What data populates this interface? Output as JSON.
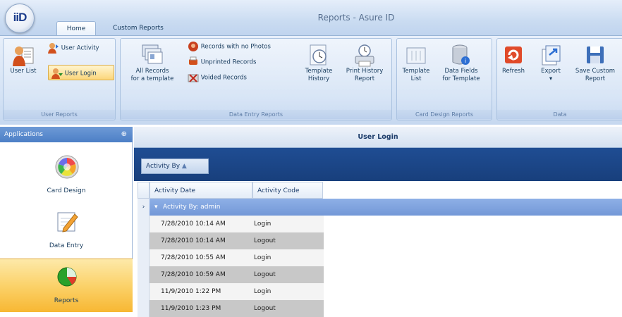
{
  "window": {
    "title": "Reports - Asure ID",
    "logo_text": "iiD"
  },
  "tabs": [
    {
      "label": "Home",
      "active": true
    },
    {
      "label": "Custom Reports",
      "active": false
    }
  ],
  "ribbon": {
    "groups": [
      {
        "name": "User Reports",
        "buttons": [
          "User List",
          "User Activity",
          "User Login"
        ]
      },
      {
        "name": "Data Entry Reports",
        "buttons": [
          "All Records for a template",
          "Records with no Photos",
          "Unprinted Records",
          "Voided Records",
          "Template History",
          "Print History Report"
        ]
      },
      {
        "name": "Card Design Reports",
        "buttons": [
          "Template List",
          "Data Fields for Template"
        ]
      },
      {
        "name": "Data",
        "buttons": [
          "Refresh",
          "Export",
          "Save Custom Report"
        ]
      }
    ],
    "labels": {
      "user_list": "User List",
      "user_activity": "User Activity",
      "user_login": "User Login",
      "all_records_1": "All Records",
      "all_records_2": "for a template",
      "no_photos": "Records with no Photos",
      "unprinted": "Unprinted Records",
      "voided": "Voided Records",
      "template_history_1": "Template",
      "template_history_2": "History",
      "print_history_1": "Print History",
      "print_history_2": "Report",
      "template_list_1": "Template",
      "template_list_2": "List",
      "data_fields_1": "Data Fields",
      "data_fields_2": "for Template",
      "refresh": "Refresh",
      "export": "Export",
      "save_custom_1": "Save Custom",
      "save_custom_2": "Report",
      "group_user_reports": "User Reports",
      "group_data_entry": "Data Entry Reports",
      "group_card_design": "Card Design Reports",
      "group_data": "Data"
    }
  },
  "sidebar": {
    "header": "Applications",
    "items": [
      {
        "label": "Card Design",
        "icon": "color-wheel-icon"
      },
      {
        "label": "Data Entry",
        "icon": "pencil-note-icon"
      },
      {
        "label": "Reports",
        "icon": "pie-chart-icon",
        "selected": true
      }
    ]
  },
  "main": {
    "title": "User Login",
    "group_by_chip": "Activity By",
    "columns": [
      "Activity Date",
      "Activity Code"
    ],
    "group_row": "Activity By: admin",
    "rows": [
      {
        "date": "7/28/2010 10:14 AM",
        "code": "Login"
      },
      {
        "date": "7/28/2010 10:14 AM",
        "code": "Logout"
      },
      {
        "date": "7/28/2010 10:55 AM",
        "code": "Login"
      },
      {
        "date": "7/28/2010 10:59 AM",
        "code": "Logout"
      },
      {
        "date": "11/9/2010 1:22 PM",
        "code": "Login"
      },
      {
        "date": "11/9/2010 1:23 PM",
        "code": "Logout"
      }
    ]
  },
  "colors": {
    "accent": "#4c7fc6",
    "selected": "#fbd26a",
    "group_row": "#7f9fdc"
  }
}
